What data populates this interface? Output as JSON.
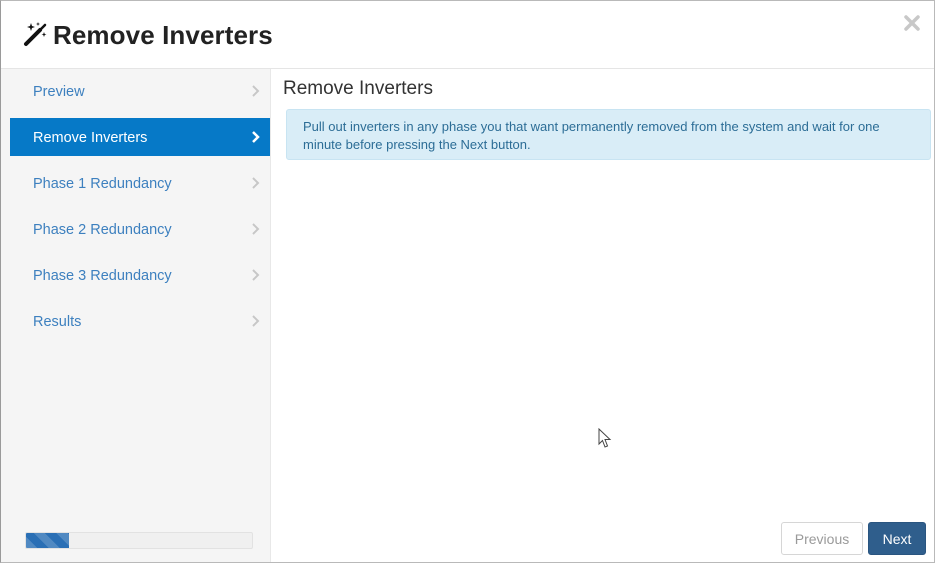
{
  "dialog": {
    "title": "Remove Inverters",
    "title_icon": "magic-wand-icon",
    "close_icon": "close-icon"
  },
  "sidebar": {
    "items": [
      {
        "label": "Preview",
        "active": false
      },
      {
        "label": "Remove Inverters",
        "active": true
      },
      {
        "label": "Phase 1 Redundancy",
        "active": false
      },
      {
        "label": "Phase 2 Redundancy",
        "active": false
      },
      {
        "label": "Phase 3 Redundancy",
        "active": false
      },
      {
        "label": "Results",
        "active": false
      }
    ],
    "progress_percent": 19
  },
  "main": {
    "title": "Remove Inverters",
    "alert": "Pull out inverters in any phase you that want permanently removed from the system and wait for one minute before pressing the Next button."
  },
  "footer": {
    "previous_label": "Previous",
    "next_label": "Next"
  },
  "colors": {
    "active_item": "#0679c7",
    "link": "#3d80bf",
    "alert_bg": "#d9edf7",
    "next_button": "#2f5e8c"
  }
}
